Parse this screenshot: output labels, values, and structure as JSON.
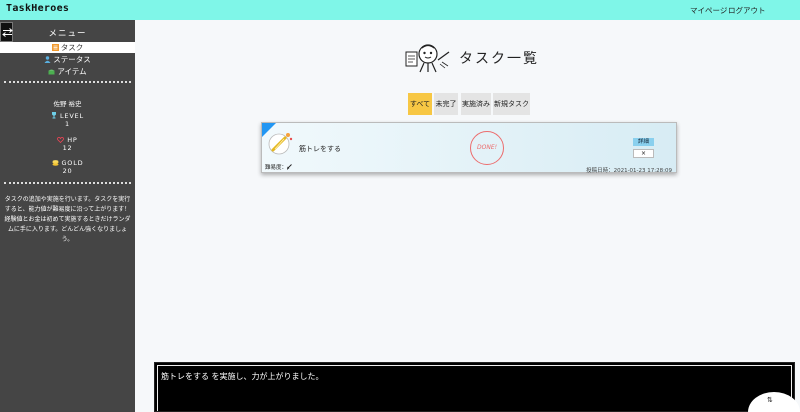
{
  "header": {
    "brand": "TaskHeroes",
    "nav": {
      "mypage": "マイページ",
      "logout": "ログアウト"
    }
  },
  "sidebar": {
    "title": "メニュー",
    "items": [
      {
        "label": "タスク",
        "icon": "list-icon",
        "active": true
      },
      {
        "label": "ステータス",
        "icon": "person-icon",
        "active": false
      },
      {
        "label": "アイテム",
        "icon": "treasure-icon",
        "active": false
      }
    ],
    "user_name": "佐野 裕史",
    "stats": {
      "level_label": "LEVEL",
      "level_value": "1",
      "hp_label": "HP",
      "hp_value": "12",
      "gold_label": "GOLD",
      "gold_value": "20"
    },
    "description": "タスクの追加や実施を行います。タスクを実行すると、能力値が難易度に沿って上がります！経験値とお金は初めて実施するときだけランダムに手に入ります。どんどん強くなりましょう。"
  },
  "main": {
    "title": "タスク一覧",
    "filters": [
      {
        "label": "すべて",
        "active": true
      },
      {
        "label": "未完了",
        "active": false
      },
      {
        "label": "実施済み",
        "active": false
      },
      {
        "label": "新規タスク",
        "active": false
      }
    ],
    "task": {
      "name": "筋トレをする",
      "difficulty": "難易度：",
      "stamp": "DONE!",
      "detail": "詳細",
      "delete": "×",
      "posted": "投稿日時：2021-01-23  17:28:09"
    }
  },
  "message": {
    "text": "筋トレをする を実施し、力が上がりました。"
  },
  "scroll_button": "⇅",
  "colors": {
    "header": "#7ff6e8",
    "sidebar": "#454545",
    "active_filter": "#f7c744",
    "stamp": "#ee5555"
  }
}
